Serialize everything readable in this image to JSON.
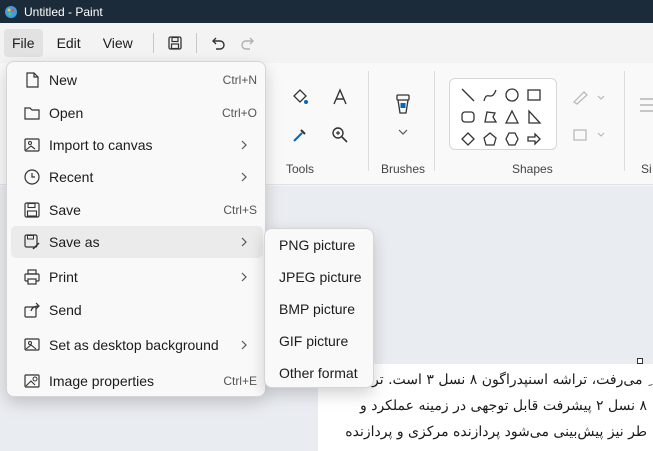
{
  "window": {
    "title": "Untitled - Paint"
  },
  "menubar": {
    "file": "File",
    "edit": "Edit",
    "view": "View"
  },
  "ribbon": {
    "tools_label": "Tools",
    "brushes_label": "Brushes",
    "shapes_label": "Shapes",
    "size_label": "Si"
  },
  "file_menu": {
    "items": [
      {
        "label": "New",
        "shortcut": "Ctrl+N",
        "icon": "new-file-icon"
      },
      {
        "label": "Open",
        "shortcut": "Ctrl+O",
        "icon": "folder-icon"
      },
      {
        "label": "Import to canvas",
        "shortcut": "",
        "icon": "import-image-icon"
      },
      {
        "label": "Recent",
        "shortcut": "",
        "icon": "clock-icon"
      },
      {
        "label": "Save",
        "shortcut": "Ctrl+S",
        "icon": "save-icon"
      },
      {
        "label": "Save as",
        "shortcut": "",
        "icon": "save-as-icon"
      },
      {
        "label": "Print",
        "shortcut": "",
        "icon": "printer-icon"
      },
      {
        "label": "Send",
        "shortcut": "",
        "icon": "share-icon"
      },
      {
        "label": "Set as desktop background",
        "shortcut": "",
        "icon": "desktop-icon"
      },
      {
        "label": "Image properties",
        "shortcut": "Ctrl+E",
        "icon": "image-properties-icon"
      }
    ]
  },
  "save_as_menu": {
    "items": [
      "PNG picture",
      "JPEG picture",
      "BMP picture",
      "GIF picture",
      "Other format"
    ]
  },
  "canvas_text": [
    "ِ می‌رفت، تراشه اسنپدراگون ۸ نسل ۳ است. تر",
    "۸ نسل ۲ پیشرفت قابل توجهی در زمینه عملکرد و",
    "طر نیز پیش‌بینی می‌شود پردازنده مرکزی و پردازنده"
  ],
  "colors": {
    "titlebar": "#1c2b3a",
    "accent": "#0067c0",
    "menu_bg": "#f9f9f9"
  }
}
